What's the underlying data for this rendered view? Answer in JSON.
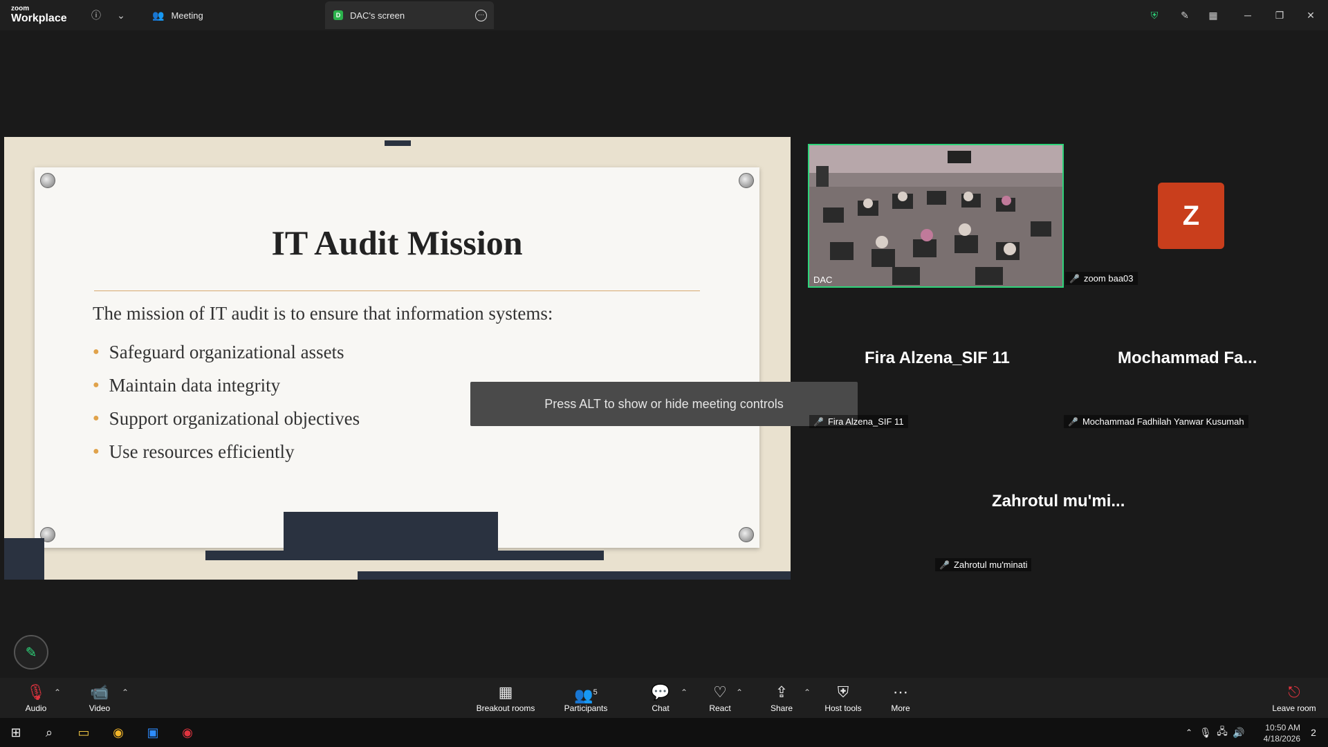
{
  "app": {
    "logo_small": "zoom",
    "logo_big": "Workplace",
    "tab_meeting": "Meeting",
    "tab_screen": "DAC's screen",
    "tab_screen_badge": "D"
  },
  "slide": {
    "title": "IT Audit Mission",
    "intro": "The mission of IT audit is to ensure that information systems:",
    "bullets": [
      "Safeguard organizational assets",
      "Maintain data integrity",
      "Support organizational objectives",
      "Use resources efficiently"
    ]
  },
  "tooltip": "Press ALT to show or hide meeting controls",
  "participants": {
    "video_tile_name": "DAC",
    "avatar_letter": "Z",
    "avatar_name": "zoom baa03",
    "fira_big": "Fira Alzena_SIF 11",
    "fira_tag": "Fira Alzena_SIF 11",
    "moch_big": "Mochammad  Fa...",
    "moch_tag": "Mochammad Fadhilah Yanwar Kusumah",
    "zah_big": "Zahrotul  mu'mi...",
    "zah_tag": "Zahrotul mu'minati"
  },
  "toolbar": {
    "audio": "Audio",
    "video": "Video",
    "breakout": "Breakout rooms",
    "participants": "Participants",
    "participants_count": "5",
    "chat": "Chat",
    "react": "React",
    "share": "Share",
    "host_tools": "Host tools",
    "more": "More",
    "leave": "Leave room"
  },
  "taskbar": {
    "time": "10:50 AM",
    "date": "4/18/2026",
    "notifications": "2"
  },
  "colors": {
    "accent_green": "#2ed47a",
    "avatar_orange": "#c93e1c",
    "mute_red": "#e0343f"
  }
}
